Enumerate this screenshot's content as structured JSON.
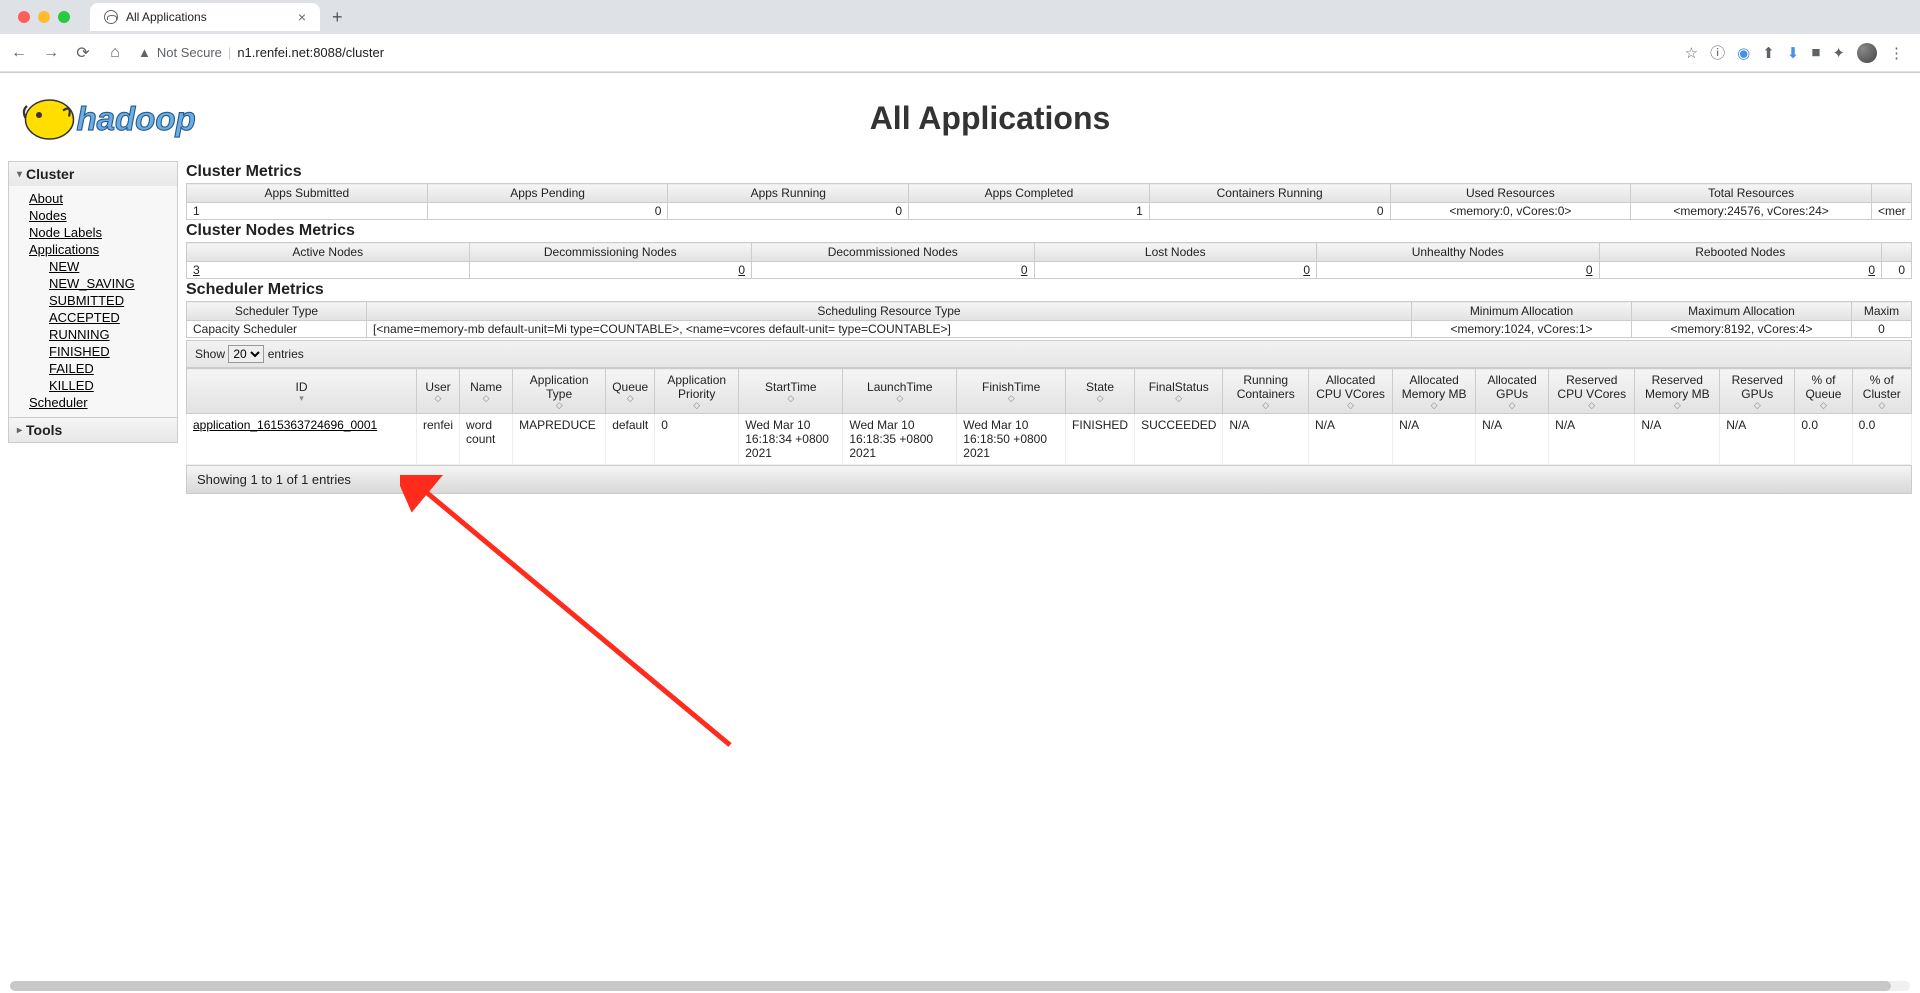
{
  "browser": {
    "tab_title": "All Applications",
    "not_secure": "Not Secure",
    "url": "n1.renfei.net:8088/cluster"
  },
  "page_title": "All Applications",
  "sidebar": {
    "cluster_label": "Cluster",
    "tools_label": "Tools",
    "items": {
      "about": "About",
      "nodes": "Nodes",
      "node_labels": "Node Labels",
      "applications": "Applications",
      "scheduler": "Scheduler"
    },
    "app_states": {
      "new": "NEW",
      "new_saving": "NEW_SAVING",
      "submitted": "SUBMITTED",
      "accepted": "ACCEPTED",
      "running": "RUNNING",
      "finished": "FINISHED",
      "failed": "FAILED",
      "killed": "KILLED"
    }
  },
  "cluster_metrics": {
    "title": "Cluster Metrics",
    "headers": [
      "Apps Submitted",
      "Apps Pending",
      "Apps Running",
      "Apps Completed",
      "Containers Running",
      "Used Resources",
      "Total Resources",
      ""
    ],
    "values": [
      "1",
      "0",
      "0",
      "1",
      "0",
      "<memory:0, vCores:0>",
      "<memory:24576, vCores:24>",
      "<mer"
    ]
  },
  "nodes_metrics": {
    "title": "Cluster Nodes Metrics",
    "headers": [
      "Active Nodes",
      "Decommissioning Nodes",
      "Decommissioned Nodes",
      "Lost Nodes",
      "Unhealthy Nodes",
      "Rebooted Nodes",
      ""
    ],
    "values": [
      "3",
      "0",
      "0",
      "0",
      "0",
      "0",
      "0"
    ]
  },
  "scheduler_metrics": {
    "title": "Scheduler Metrics",
    "headers": [
      "Scheduler Type",
      "Scheduling Resource Type",
      "Minimum Allocation",
      "Maximum Allocation",
      "Maxim"
    ],
    "values": [
      "Capacity Scheduler",
      "[<name=memory-mb default-unit=Mi type=COUNTABLE>, <name=vcores default-unit= type=COUNTABLE>]",
      "<memory:1024, vCores:1>",
      "<memory:8192, vCores:4>",
      "0"
    ]
  },
  "show_entries": {
    "prefix": "Show",
    "value": "20",
    "suffix": "entries"
  },
  "app_table": {
    "headers": [
      "ID",
      "User",
      "Name",
      "Application Type",
      "Queue",
      "Application Priority",
      "StartTime",
      "LaunchTime",
      "FinishTime",
      "State",
      "FinalStatus",
      "Running Containers",
      "Allocated CPU VCores",
      "Allocated Memory MB",
      "Allocated GPUs",
      "Reserved CPU VCores",
      "Reserved Memory MB",
      "Reserved GPUs",
      "% of Queue",
      "% of Cluster"
    ],
    "row": {
      "id": "application_1615363724696_0001",
      "user": "renfei",
      "name": "word count",
      "type": "MAPREDUCE",
      "queue": "default",
      "priority": "0",
      "start": "Wed Mar 10 16:18:34 +0800 2021",
      "launch": "Wed Mar 10 16:18:35 +0800 2021",
      "finish": "Wed Mar 10 16:18:50 +0800 2021",
      "state": "FINISHED",
      "final": "SUCCEEDED",
      "running_c": "N/A",
      "alloc_cpu": "N/A",
      "alloc_mem": "N/A",
      "alloc_gpu": "N/A",
      "res_cpu": "N/A",
      "res_mem": "N/A",
      "res_gpu": "N/A",
      "pct_q": "0.0",
      "pct_c": "0.0"
    },
    "footer": "Showing 1 to 1 of 1 entries"
  }
}
